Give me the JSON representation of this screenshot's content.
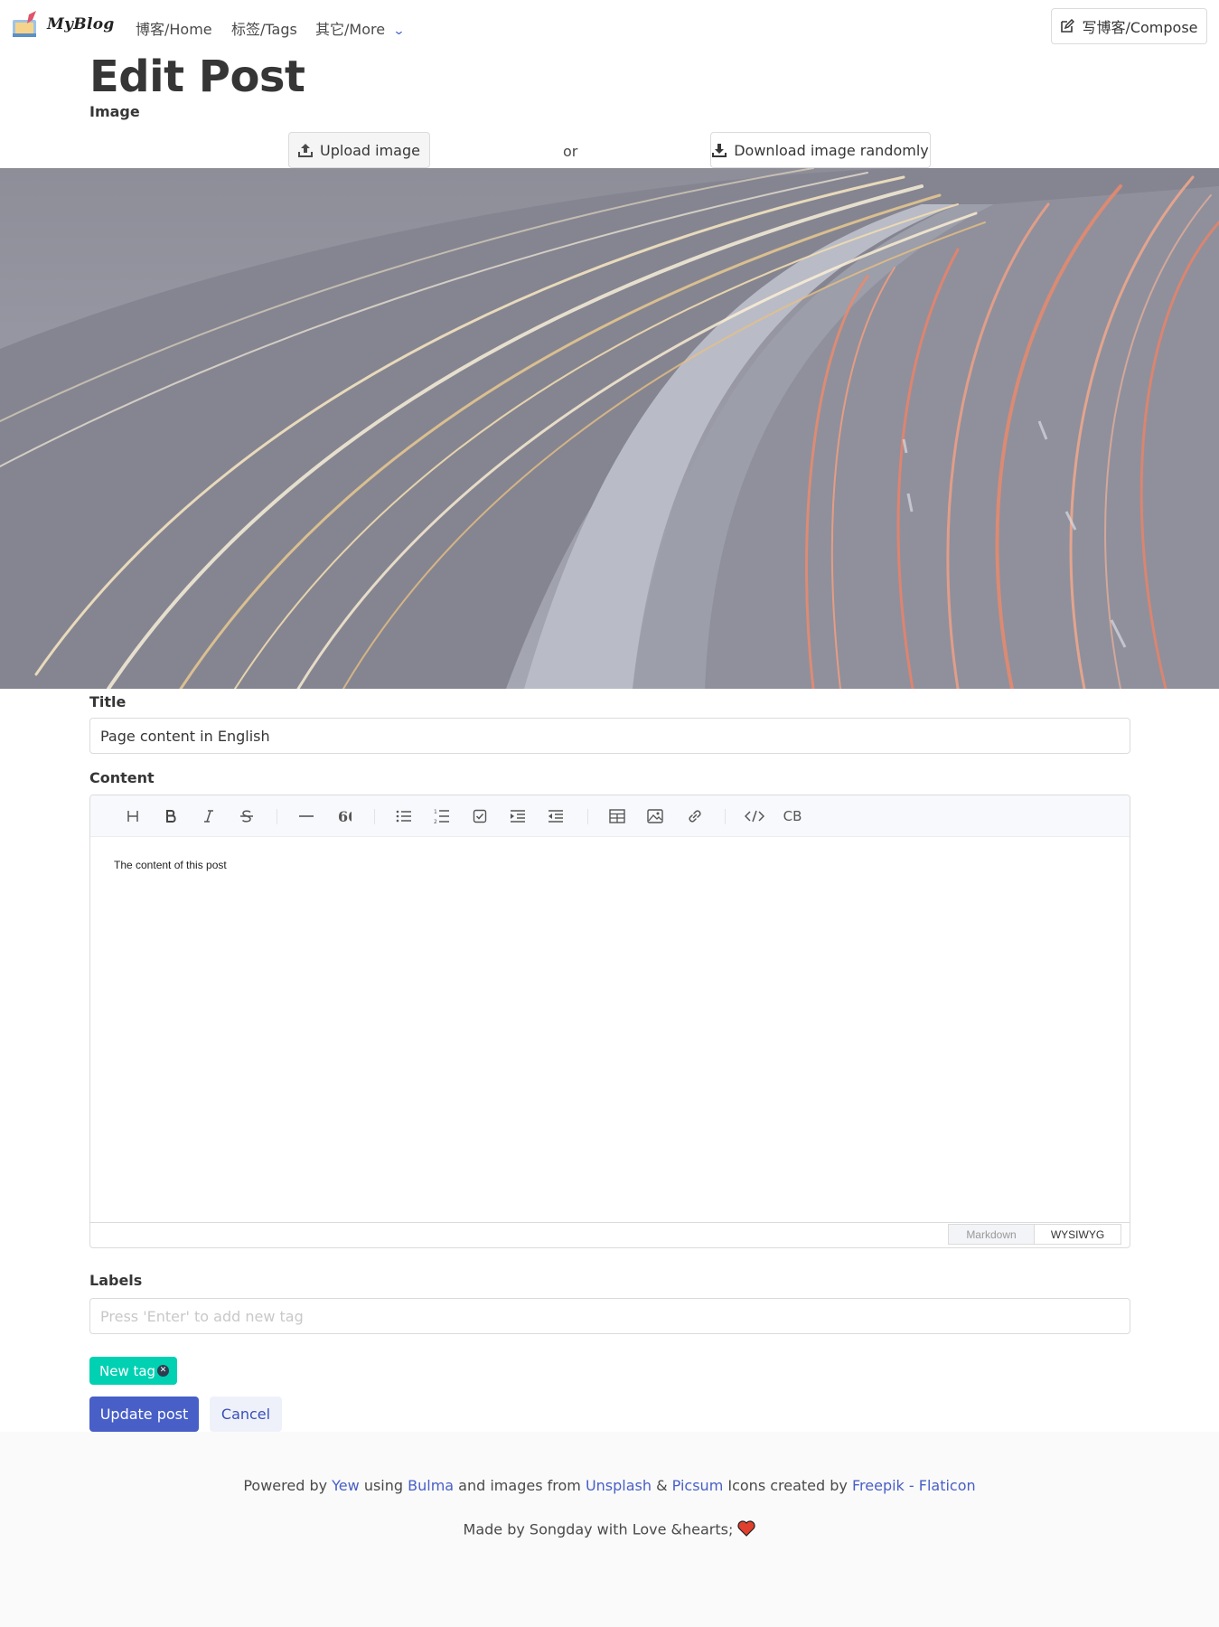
{
  "navbar": {
    "brand": "MyBlog",
    "home": "博客/Home",
    "tags": "标签/Tags",
    "more": "其它/More",
    "compose": "写博客/Compose"
  },
  "page": {
    "title": "Edit Post"
  },
  "image_section": {
    "label": "Image",
    "upload": "Upload image",
    "or": "or",
    "download": "Download image randomly"
  },
  "title_field": {
    "label": "Title",
    "value": "Page content in English"
  },
  "content_field": {
    "label": "Content",
    "text": "The content of this post",
    "toolbar": [
      "heading-icon",
      "bold-icon",
      "italic-icon",
      "strike-icon",
      "hr-icon",
      "quote-icon",
      "ul-icon",
      "ol-icon",
      "task-icon",
      "indent-icon",
      "outdent-icon",
      "table-icon",
      "image-icon",
      "link-icon",
      "code-icon",
      "codeblock-icon"
    ],
    "codeblock_label": "CB",
    "mode_markdown": "Markdown",
    "mode_wysiwyg": "WYSIWYG"
  },
  "labels_field": {
    "label": "Labels",
    "placeholder": "Press 'Enter' to add new tag",
    "tags": [
      "New tag"
    ]
  },
  "actions": {
    "update": "Update post",
    "cancel": "Cancel"
  },
  "footer": {
    "line1_parts": [
      "Powered by ",
      "Yew",
      " using ",
      "Bulma",
      " and images from ",
      "Unsplash",
      " & ",
      "Picsum",
      " Icons created by ",
      "Freepik - Flaticon"
    ],
    "line2": "Made by Songday with Love &hearts; "
  },
  "colors": {
    "primary": "#485fc7",
    "tag": "#00d1b2",
    "footer_bg": "#fafafa"
  }
}
